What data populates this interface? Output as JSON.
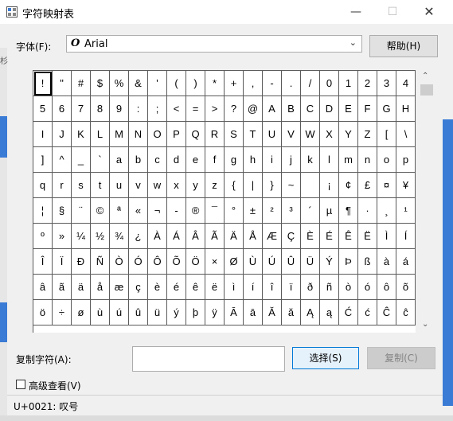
{
  "window": {
    "title": "字符映射表",
    "minimize_glyph": "—",
    "maximize_glyph": "☐",
    "close_glyph": "✕"
  },
  "edge": {
    "left_char": "杉"
  },
  "font": {
    "label": "字体(F):",
    "icon_glyph": "O",
    "value": "Arial",
    "chevron": "⌄"
  },
  "help_button": "帮助(H)",
  "grid": {
    "selected_char": "!",
    "rows": [
      [
        "!",
        "\"",
        "#",
        "$",
        "%",
        "&",
        "'",
        "(",
        ")",
        "*",
        "+",
        ",",
        "-",
        ".",
        "/",
        "0",
        "1",
        "2",
        "3",
        "4"
      ],
      [
        "5",
        "6",
        "7",
        "8",
        "9",
        ":",
        ";",
        "<",
        "=",
        ">",
        "?",
        "@",
        "A",
        "B",
        "C",
        "D",
        "E",
        "F",
        "G",
        "H"
      ],
      [
        "I",
        "J",
        "K",
        "L",
        "M",
        "N",
        "O",
        "P",
        "Q",
        "R",
        "S",
        "T",
        "U",
        "V",
        "W",
        "X",
        "Y",
        "Z",
        "[",
        "\\"
      ],
      [
        "]",
        "^",
        "_",
        "`",
        "a",
        "b",
        "c",
        "d",
        "e",
        "f",
        "g",
        "h",
        "i",
        "j",
        "k",
        "l",
        "m",
        "n",
        "o",
        "p"
      ],
      [
        "q",
        "r",
        "s",
        "t",
        "u",
        "v",
        "w",
        "x",
        "y",
        "z",
        "{",
        "|",
        "}",
        "~",
        "",
        "¡",
        "¢",
        "£",
        "¤",
        "¥"
      ],
      [
        "¦",
        "§",
        "¨",
        "©",
        "ª",
        "«",
        "¬",
        "-",
        "®",
        "¯",
        "°",
        "±",
        "²",
        "³",
        "´",
        "µ",
        "¶",
        "·",
        "¸",
        "¹"
      ],
      [
        "º",
        "»",
        "¼",
        "½",
        "¾",
        "¿",
        "À",
        "Á",
        "Â",
        "Ã",
        "Ä",
        "Å",
        "Æ",
        "Ç",
        "È",
        "É",
        "Ê",
        "Ë",
        "Ì",
        "Í"
      ],
      [
        "Î",
        "Ï",
        "Ð",
        "Ñ",
        "Ò",
        "Ó",
        "Ô",
        "Õ",
        "Ö",
        "×",
        "Ø",
        "Ù",
        "Ú",
        "Û",
        "Ü",
        "Ý",
        "Þ",
        "ß",
        "à",
        "á"
      ],
      [
        "â",
        "ã",
        "ä",
        "å",
        "æ",
        "ç",
        "è",
        "é",
        "ê",
        "ë",
        "ì",
        "í",
        "î",
        "ï",
        "ð",
        "ñ",
        "ò",
        "ó",
        "ô",
        "õ"
      ],
      [
        "ö",
        "÷",
        "ø",
        "ù",
        "ú",
        "û",
        "ü",
        "ý",
        "þ",
        "ÿ",
        "Ā",
        "ā",
        "Ă",
        "ă",
        "Ą",
        "ą",
        "Ć",
        "ć",
        "Ĉ",
        "ĉ"
      ]
    ]
  },
  "scrollbar": {
    "up_glyph": "⌃",
    "down_glyph": "⌄"
  },
  "copy": {
    "label": "复制字符(A):",
    "value": "",
    "select_button": "选择(S)",
    "copy_button": "复制(C)"
  },
  "advanced": {
    "label": "高级查看(V)",
    "checked": false
  },
  "status": {
    "text": "U+0021: 叹号"
  },
  "colors": {
    "accent": "#0078d7",
    "edge_blue": "#3a7bd5"
  }
}
